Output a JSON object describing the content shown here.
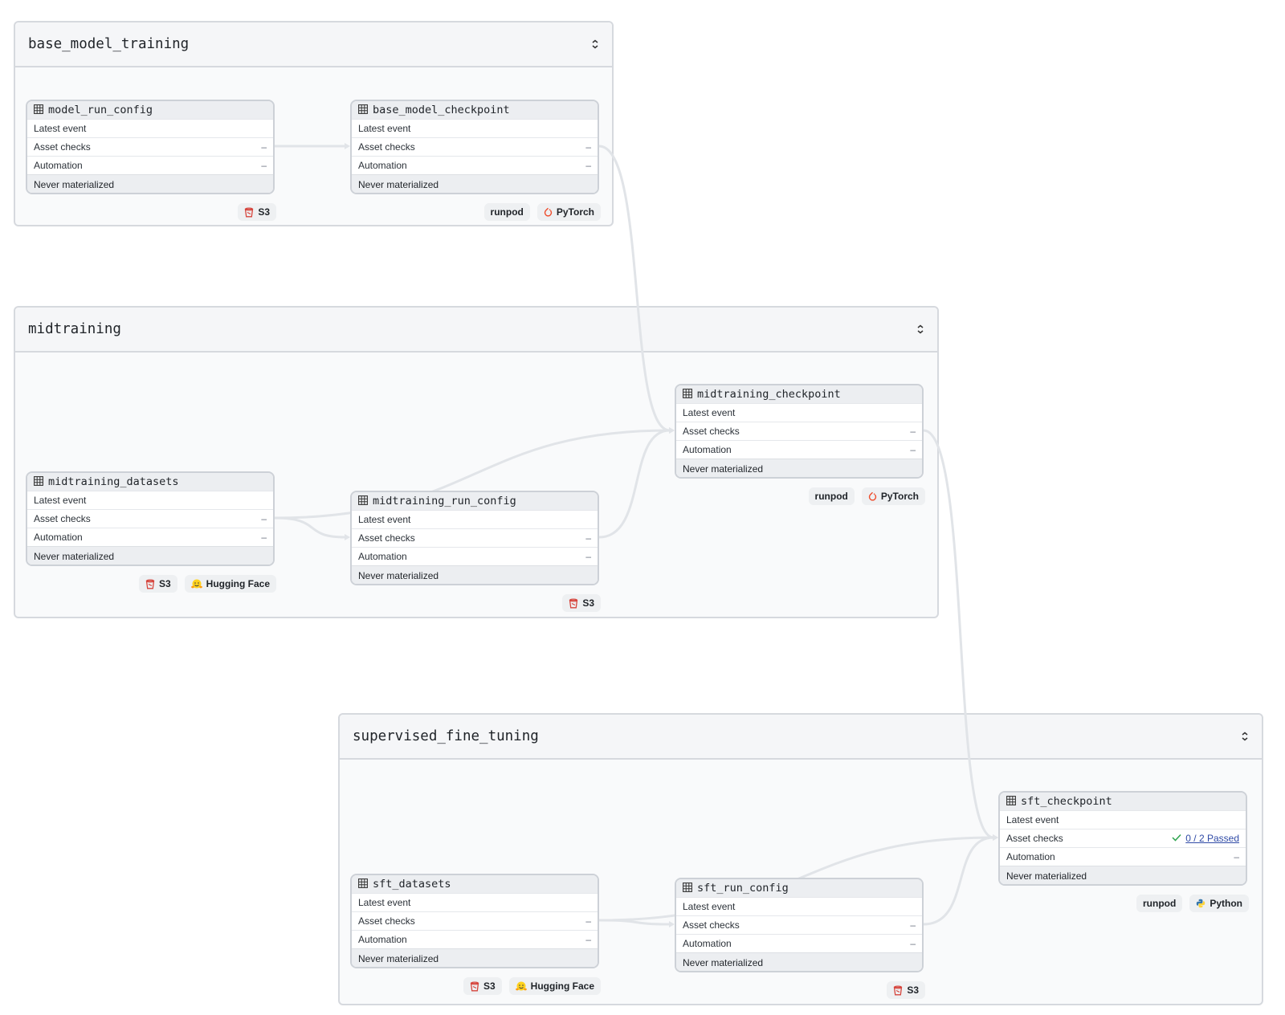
{
  "groups": [
    {
      "id": "base",
      "title": "base_model_training"
    },
    {
      "id": "mid",
      "title": "midtraining"
    },
    {
      "id": "sft",
      "title": "supervised_fine_tuning"
    }
  ],
  "row_labels": {
    "latest_event": "Latest event",
    "asset_checks": "Asset checks",
    "automation": "Automation"
  },
  "assets": [
    {
      "name": "model_run_config",
      "asset_checks": "–",
      "automation": "–",
      "status": "Never materialized",
      "tags": [
        {
          "label": "S3",
          "icon": "s3-bucket-icon"
        }
      ]
    },
    {
      "name": "base_model_checkpoint",
      "asset_checks": "–",
      "automation": "–",
      "status": "Never materialized",
      "tags": [
        {
          "label": "runpod",
          "icon": ""
        },
        {
          "label": "PyTorch",
          "icon": "pytorch-icon"
        }
      ]
    },
    {
      "name": "midtraining_datasets",
      "asset_checks": "–",
      "automation": "–",
      "status": "Never materialized",
      "tags": [
        {
          "label": "S3",
          "icon": "s3-bucket-icon"
        },
        {
          "label": "Hugging Face",
          "icon": "hugging-face-icon"
        }
      ]
    },
    {
      "name": "midtraining_run_config",
      "asset_checks": "–",
      "automation": "–",
      "status": "Never materialized",
      "tags": [
        {
          "label": "S3",
          "icon": "s3-bucket-icon"
        }
      ]
    },
    {
      "name": "midtraining_checkpoint",
      "asset_checks": "–",
      "automation": "–",
      "status": "Never materialized",
      "tags": [
        {
          "label": "runpod",
          "icon": ""
        },
        {
          "label": "PyTorch",
          "icon": "pytorch-icon"
        }
      ]
    },
    {
      "name": "sft_datasets",
      "asset_checks": "–",
      "automation": "–",
      "status": "Never materialized",
      "tags": [
        {
          "label": "S3",
          "icon": "s3-bucket-icon"
        },
        {
          "label": "Hugging Face",
          "icon": "hugging-face-icon"
        }
      ]
    },
    {
      "name": "sft_run_config",
      "asset_checks": "–",
      "automation": "–",
      "status": "Never materialized",
      "tags": [
        {
          "label": "S3",
          "icon": "s3-bucket-icon"
        }
      ]
    },
    {
      "name": "sft_checkpoint",
      "asset_checks": "0 / 2 Passed",
      "automation": "–",
      "status": "Never materialized",
      "tags": [
        {
          "label": "runpod",
          "icon": ""
        },
        {
          "label": "Python",
          "icon": "python-icon"
        }
      ]
    }
  ],
  "edges": [
    {
      "from": "model_run_config",
      "to": "base_model_checkpoint"
    },
    {
      "from": "base_model_checkpoint",
      "to": "midtraining_checkpoint"
    },
    {
      "from": "midtraining_datasets",
      "to": "midtraining_run_config"
    },
    {
      "from": "midtraining_datasets",
      "to": "midtraining_checkpoint"
    },
    {
      "from": "midtraining_run_config",
      "to": "midtraining_checkpoint"
    },
    {
      "from": "midtraining_checkpoint",
      "to": "sft_checkpoint"
    },
    {
      "from": "sft_datasets",
      "to": "sft_run_config"
    },
    {
      "from": "sft_datasets",
      "to": "sft_checkpoint"
    },
    {
      "from": "sft_run_config",
      "to": "sft_checkpoint"
    }
  ],
  "colors": {
    "edge": "#e1e4e8",
    "passed": "#2da44e",
    "link": "#2f4aa6",
    "s3": "#d6453d",
    "pytorch": "#ee4c2c"
  }
}
